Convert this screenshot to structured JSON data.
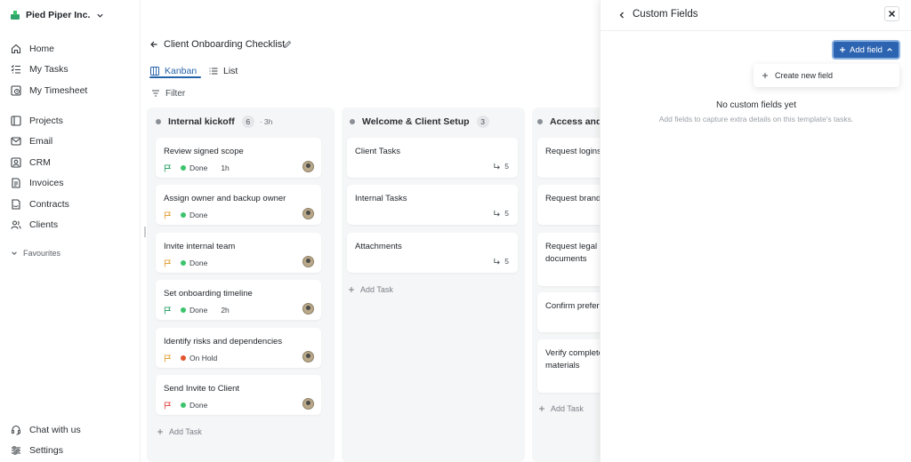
{
  "sidebar": {
    "org_name": "Pied Piper Inc.",
    "nav": [
      {
        "label": "Home",
        "icon": "home-icon"
      },
      {
        "label": "My Tasks",
        "icon": "tasks-icon"
      },
      {
        "label": "My Timesheet",
        "icon": "timesheet-icon"
      },
      {
        "label": "Projects",
        "icon": "projects-icon"
      },
      {
        "label": "Email",
        "icon": "email-icon"
      },
      {
        "label": "CRM",
        "icon": "crm-icon"
      },
      {
        "label": "Invoices",
        "icon": "invoices-icon"
      },
      {
        "label": "Contracts",
        "icon": "contracts-icon"
      },
      {
        "label": "Clients",
        "icon": "clients-icon"
      }
    ],
    "favourites_label": "Favourites",
    "bottom": [
      {
        "label": "Chat with us",
        "icon": "headset-icon"
      },
      {
        "label": "Settings",
        "icon": "settings-sliders-icon"
      }
    ]
  },
  "main": {
    "title": "Client Onboarding Checklist",
    "tabs": [
      {
        "label": "Kanban",
        "active": true
      },
      {
        "label": "List",
        "active": false
      }
    ],
    "filter_label": "Filter",
    "add_task_label": "Add Task"
  },
  "columns": [
    {
      "title": "Internal kickoff",
      "count": "6",
      "estimate": "· 3h",
      "cards": [
        {
          "title": "Review signed scope",
          "flag_color": "#2fa36b",
          "status": "Done",
          "status_color": "#3cc46d",
          "estimate": "1h"
        },
        {
          "title": "Assign owner and backup owner",
          "flag_color": "#e2a23b",
          "status": "Done",
          "status_color": "#3cc46d",
          "estimate": ""
        },
        {
          "title": "Invite internal team",
          "flag_color": "#e2a23b",
          "status": "Done",
          "status_color": "#3cc46d",
          "estimate": ""
        },
        {
          "title": "Set onboarding timeline",
          "flag_color": "#2fa36b",
          "status": "Done",
          "status_color": "#3cc46d",
          "estimate": "2h"
        },
        {
          "title": "Identify risks and dependencies",
          "flag_color": "#e2a23b",
          "status": "On Hold",
          "status_color": "#e2552f",
          "estimate": ""
        },
        {
          "title": "Send Invite to Client",
          "flag_color": "#e0504a",
          "status": "Done",
          "status_color": "#3cc46d",
          "estimate": ""
        }
      ]
    },
    {
      "title": "Welcome & Client Setup",
      "count": "3",
      "cards": [
        {
          "title": "Client Tasks",
          "subtasks": "5"
        },
        {
          "title": "Internal Tasks",
          "subtasks": "5"
        },
        {
          "title": "Attachments",
          "subtasks": "5"
        }
      ]
    },
    {
      "title": "Access and a",
      "cards": [
        {
          "title": "Request logins"
        },
        {
          "title": "Request brand"
        },
        {
          "title_line1": "Request legal c",
          "title_line2": "documents"
        },
        {
          "title": "Confirm prefere"
        },
        {
          "title_line1": "Verify complete",
          "title_line2": "materials"
        }
      ]
    }
  ],
  "panel": {
    "title": "Custom Fields",
    "add_field_label": "Add field",
    "dropdown_item": "Create new field",
    "empty_title": "No custom fields yet",
    "empty_subtitle": "Add fields to capture extra details on this template's tasks."
  },
  "colors": {
    "accent": "#2563a8",
    "primary_button": "#2d64b2",
    "done": "#3cc46d",
    "on_hold": "#e2552f"
  }
}
